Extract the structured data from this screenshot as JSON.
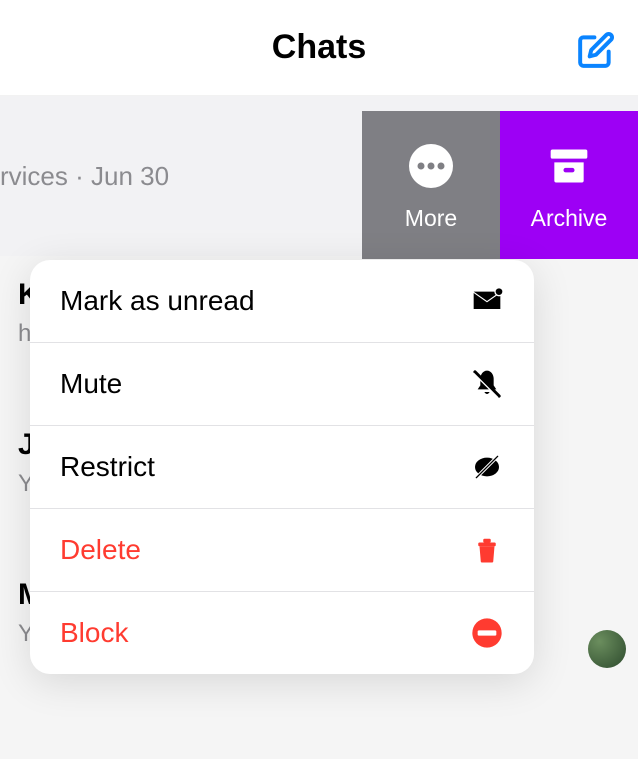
{
  "header": {
    "title": "Chats"
  },
  "swiped_row": {
    "preview": "rvices · Jun 30"
  },
  "swipe_actions": {
    "more_label": "More",
    "archive_label": "Archive"
  },
  "popup": {
    "mark_unread": "Mark as unread",
    "mute": "Mute",
    "restrict": "Restrict",
    "delete": "Delete",
    "block": "Block"
  },
  "bg_rows": [
    {
      "initial": "K",
      "sub": "h"
    },
    {
      "initial": "J",
      "sub": "Y"
    },
    {
      "initial": "M",
      "sub": "Y"
    }
  ]
}
